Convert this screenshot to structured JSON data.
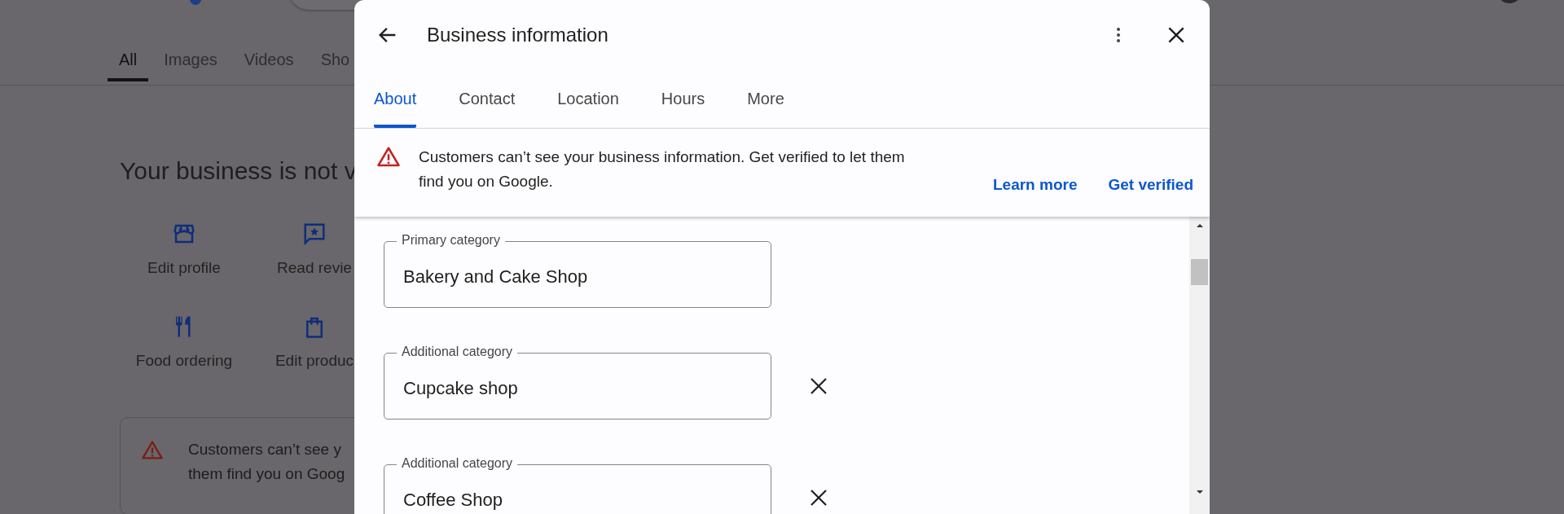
{
  "background": {
    "tabs": [
      {
        "label": "All",
        "selected": true
      },
      {
        "label": "Images",
        "selected": false
      },
      {
        "label": "Videos",
        "selected": false
      },
      {
        "label": "Sho",
        "selected": false
      }
    ],
    "heading": "Your business is not v",
    "actions": [
      {
        "kind": "store",
        "label": "Edit profile"
      },
      {
        "kind": "review",
        "label": "Read revie"
      },
      {
        "kind": "food",
        "label": "Food ordering"
      },
      {
        "kind": "bag",
        "label": "Edit produc"
      }
    ],
    "alert_lines": [
      "Customers can’t see y",
      "them find you on Goog"
    ]
  },
  "dialog": {
    "title": "Business information",
    "tabs": [
      {
        "label": "About",
        "selected": true
      },
      {
        "label": "Contact",
        "selected": false
      },
      {
        "label": "Location",
        "selected": false
      },
      {
        "label": "Hours",
        "selected": false
      },
      {
        "label": "More",
        "selected": false
      }
    ],
    "banner": {
      "text": "Customers can’t see your business information. Get verified to let them find you on Google.",
      "links": [
        "Learn more",
        "Get verified"
      ]
    },
    "fields": [
      {
        "label": "Primary category",
        "value": "Bakery and Cake Shop",
        "removable": false
      },
      {
        "label": "Additional category",
        "value": "Cupcake shop",
        "removable": true
      },
      {
        "label": "Additional category",
        "value": "Coffee Shop",
        "removable": true
      }
    ]
  }
}
